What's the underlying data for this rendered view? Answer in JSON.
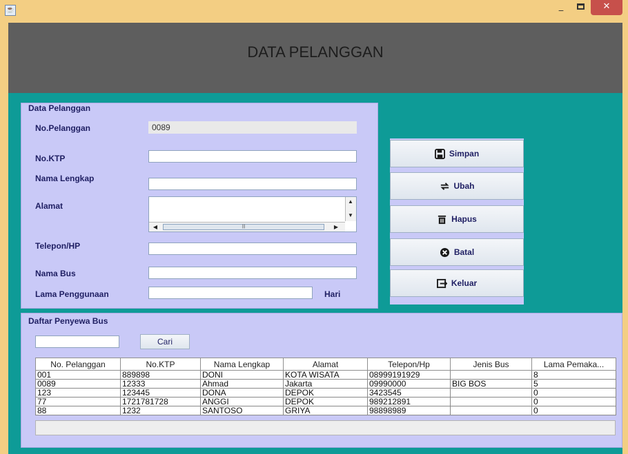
{
  "window": {
    "minimize": "_",
    "close": "✕"
  },
  "header": {
    "title": "DATA PELANGGAN"
  },
  "form": {
    "panel_title": "Data Pelanggan",
    "no_pelanggan_label": "No.Pelanggan",
    "no_pelanggan_value": "0089",
    "no_ktp_label": "No.KTP",
    "no_ktp_value": "",
    "nama_lengkap_label": "Nama Lengkap",
    "nama_lengkap_value": "",
    "alamat_label": "Alamat",
    "alamat_value": "",
    "telepon_label": "Telepon/HP",
    "telepon_value": "",
    "nama_bus_label": "Nama Bus",
    "nama_bus_value": "",
    "lama_label": "Lama Penggunaan",
    "lama_value": "",
    "hari_label": "Hari"
  },
  "actions": {
    "simpan": "Simpan",
    "ubah": "Ubah",
    "hapus": "Hapus",
    "batal": "Batal",
    "keluar": "Keluar"
  },
  "list": {
    "panel_title": "Daftar Penyewa Bus",
    "search_value": "",
    "search_button": "Cari",
    "columns": [
      "No. Pelanggan",
      "No.KTP",
      "Nama Lengkap",
      "Alamat",
      "Telepon/Hp",
      "Jenis Bus",
      "Lama Pemaka..."
    ],
    "rows": [
      [
        "001",
        "889898",
        "DONI",
        "KOTA WISATA",
        "08999191929",
        "",
        "8"
      ],
      [
        "0089",
        "12333",
        "Ahmad",
        "Jakarta",
        "09990000",
        "BIG BOS",
        "5"
      ],
      [
        "123",
        "123445",
        "DONA",
        "DEPOK",
        "3423545",
        "",
        "0"
      ],
      [
        "77",
        "1721781728",
        "ANGGI",
        "DEPOK",
        "989212891",
        "",
        "0"
      ],
      [
        "88",
        "1232",
        "SANTOSO",
        "GRIYA",
        "98898989",
        "",
        "0"
      ]
    ]
  }
}
